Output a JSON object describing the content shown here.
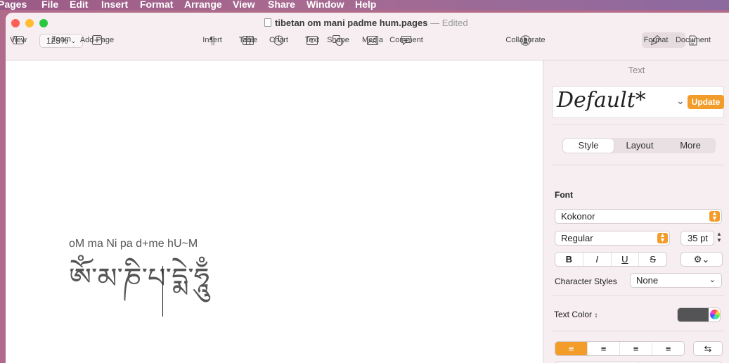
{
  "menubar": {
    "app": "Pages",
    "items": [
      "File",
      "Edit",
      "Insert",
      "Format",
      "Arrange",
      "View",
      "Share",
      "Window",
      "Help"
    ]
  },
  "window": {
    "title": "tibetan om mani padme hum.pages",
    "title_sep": "—",
    "status": "Edited"
  },
  "toolbar": {
    "view": "View",
    "zoom_value": "125%",
    "zoom": "Zoom",
    "add_page": "Add Page",
    "insert": "Insert",
    "table": "Table",
    "chart": "Chart",
    "text": "Text",
    "shape": "Shape",
    "media": "Media",
    "comment": "Comment",
    "collaborate": "Collaborate",
    "format": "Format",
    "document": "Document"
  },
  "document": {
    "transliteration": "oM ma Ni pa d+me hU~M",
    "tibetan": "ཨོཾ་མ་ཎི་པ་དྨེ་ཧཱུྃ"
  },
  "inspector": {
    "title": "Text",
    "paragraph_style": "Default*",
    "update": "Update",
    "tabs": [
      "Style",
      "Layout",
      "More"
    ],
    "font_label": "Font",
    "font_name": "Kokonor",
    "font_style": "Regular",
    "font_size": "35 pt",
    "bold": "B",
    "italic": "I",
    "underline": "U",
    "strike": "S",
    "char_styles_label": "Character Styles",
    "char_styles_value": "None",
    "text_color_label": "Text Color",
    "text_color": "#545456",
    "accent": "#f39c2a"
  }
}
